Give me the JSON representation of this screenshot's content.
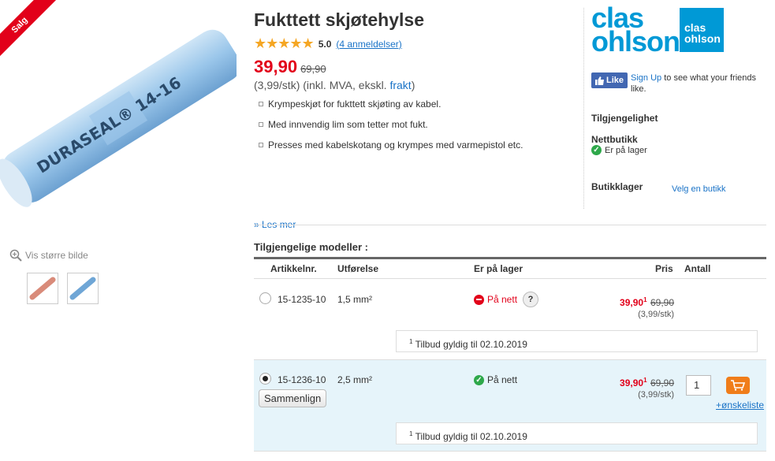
{
  "product": {
    "sale_badge": "Salg",
    "title": "Fukttett skjøtehylse",
    "rating_stars": "★★★★★",
    "rating_value": "5.0",
    "reviews_link": "(4 anmeldelser)",
    "price_now": "39,90",
    "price_old": "69,90",
    "unit_price": "(3,99/stk)",
    "vat_text": "(inkl. MVA,  ekskl.",
    "frakt": "frakt",
    "frakt_close": ")",
    "bullets": [
      "Krympeskjøt for fukttett skjøting av kabel.",
      "Med innvendig lim som tetter mot fukt.",
      "Presses med kabelskotang og krympes med varmepistol etc."
    ],
    "read_more": "» Les mer",
    "zoom_label": "Vis større bilde",
    "image_label": "DURASEAL® 14-16"
  },
  "brand": {
    "logo_line1": "clas",
    "logo_line2": "ohlson",
    "box_line1": "clas",
    "box_line2": "ohlson"
  },
  "facebook": {
    "like_label": "Like",
    "sign_up": "Sign Up",
    "text": " to see what your friends like."
  },
  "availability": {
    "heading": "Tilgjengelighet",
    "online_heading": "Nettbutikk",
    "online_status": "Er på lager",
    "store_heading": "Butikklager",
    "choose_store": "Velg en butikk"
  },
  "models": {
    "heading": "Tilgjengelige modeller :",
    "columns": {
      "article": "Artikkelnr.",
      "variant": "Utførelse",
      "stock": "Er på lager",
      "price": "Pris",
      "qty": "Antall"
    },
    "rows": [
      {
        "article": "15-1235-10",
        "variant": "1,5 mm²",
        "stock": "På nett",
        "help": "?",
        "price_now": "39,90",
        "sup": "1",
        "price_old": "69,90",
        "unit": "(3,99/stk)",
        "offer_sup": "1",
        "offer": " Tilbud gyldig til 02.10.2019"
      },
      {
        "article": "15-1236-10",
        "variant": "2,5 mm²",
        "stock": "På nett",
        "price_now": "39,90",
        "sup": "1",
        "price_old": "69,90",
        "unit": "(3,99/stk)",
        "qty": "1",
        "wishlist": "+ønskeliste",
        "compare": "Sammenlign",
        "offer_sup": "1",
        "offer": " Tilbud gyldig til 02.10.2019"
      }
    ]
  },
  "colors": {
    "accent_red": "#e2001a",
    "brand_blue": "#0099d6",
    "link_blue": "#1a73c7",
    "selected_row": "#e6f4fa",
    "cart_orange": "#f07d1a"
  }
}
